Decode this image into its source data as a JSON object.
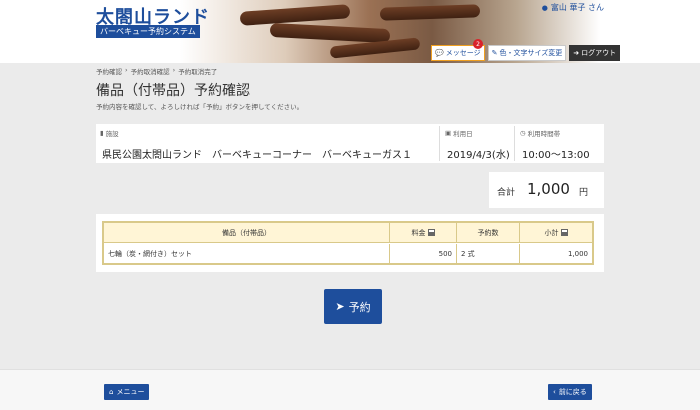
{
  "header": {
    "logo_title": "太閤山ランド",
    "logo_subtitle": "バーベキュー予約システム",
    "user_name": "富山 華子 さん",
    "buttons": {
      "messages": "メッセージ",
      "messages_badge": "2",
      "display_settings": "色・文字サイズ変更",
      "logout": "ログアウト"
    }
  },
  "breadcrumb": {
    "items": [
      "予約確認",
      "予約取消確認",
      "予約取消完了"
    ],
    "separator": "›"
  },
  "page": {
    "title": "備品（付帯品）予約確認",
    "instruction": "予約内容を確認して、よろしければ「予約」ボタンを押してください。"
  },
  "reservation": {
    "facility_label": "施設",
    "facility_value": "県民公園太閤山ランド　バーベキューコーナー　バーベキューガス１",
    "date_label": "利用日",
    "date_value": "2019/4/3(水)",
    "time_label": "利用時間帯",
    "time_value": "10:00～13:00"
  },
  "total": {
    "label": "合計",
    "value": "1,000",
    "unit": "円"
  },
  "table": {
    "headers": [
      "備品（付帯品）",
      "料金",
      "予約数",
      "小計"
    ],
    "rows": [
      {
        "item": "七輪（炭・網付き）セット",
        "price": "500",
        "quantity": "2 式",
        "subtotal": "1,000"
      }
    ]
  },
  "actions": {
    "reserve": "予約",
    "menu": "メニュー",
    "back": "前に戻る"
  },
  "colors": {
    "brand": "#1e4e9c",
    "table_border": "#d9c98a",
    "table_header_bg": "#fff5d6",
    "badge": "#d9232a"
  }
}
